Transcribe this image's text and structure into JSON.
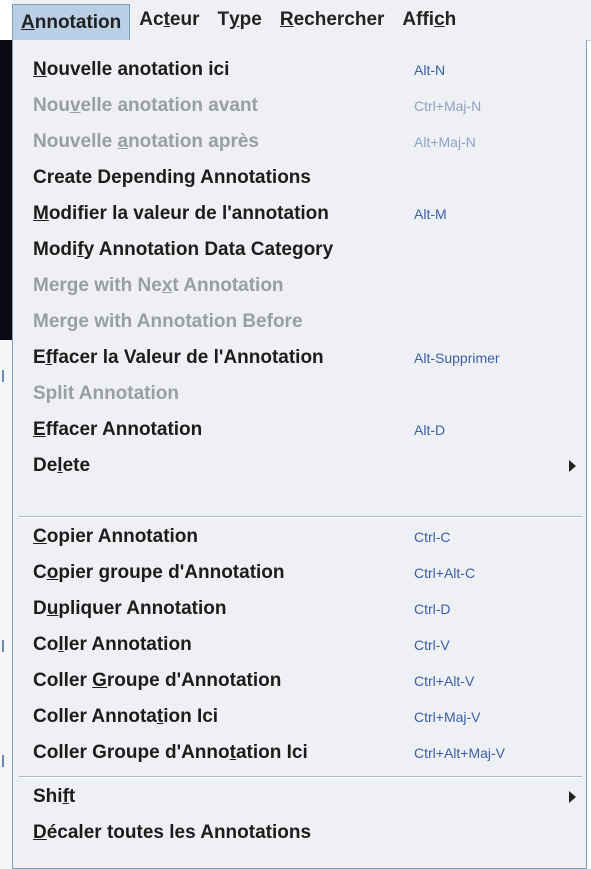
{
  "menubar": {
    "items": [
      {
        "pre": "",
        "u": "A",
        "post": "nnotation",
        "active": true
      },
      {
        "pre": "Ac",
        "u": "t",
        "post": "eur",
        "active": false
      },
      {
        "pre": "T",
        "u": "y",
        "post": "pe",
        "active": false
      },
      {
        "pre": "",
        "u": "R",
        "post": "echercher",
        "active": false
      },
      {
        "pre": "Affi",
        "u": "c",
        "post": "h",
        "active": false
      }
    ]
  },
  "menu": {
    "groups": [
      [
        {
          "pre": "",
          "u": "N",
          "post": "ouvelle anotation ici",
          "accel": "Alt-N",
          "enabled": true
        },
        {
          "pre": "Nou",
          "u": "v",
          "post": "elle anotation avant",
          "accel": "Ctrl+Maj-N",
          "enabled": false
        },
        {
          "pre": "Nouvelle ",
          "u": "a",
          "post": "notation après",
          "accel": "Alt+Maj-N",
          "enabled": false
        },
        {
          "pre": "Create Depending Annotations",
          "u": "",
          "post": "",
          "accel": "",
          "enabled": true
        },
        {
          "pre": "",
          "u": "M",
          "post": "odifier la valeur de l'annotation",
          "accel": "Alt-M",
          "enabled": true
        },
        {
          "pre": "Modi",
          "u": "f",
          "post": "y Annotation Data Category",
          "accel": "",
          "enabled": true
        },
        {
          "pre": "Merge with Ne",
          "u": "x",
          "post": "t Annotation",
          "accel": "",
          "enabled": false
        },
        {
          "pre": "Merge with Annotation Before",
          "u": "",
          "post": "",
          "accel": "",
          "enabled": false
        },
        {
          "pre": "E",
          "u": "f",
          "post": "facer la Valeur de l'Annotation",
          "accel": "Alt-Supprimer",
          "enabled": true
        },
        {
          "pre": "Split Annotation",
          "u": "",
          "post": "",
          "accel": "",
          "enabled": false
        },
        {
          "pre": "",
          "u": "E",
          "post": "ffacer Annotation",
          "accel": "Alt-D",
          "enabled": true
        },
        {
          "pre": "De",
          "u": "l",
          "post": "ete",
          "accel": "",
          "enabled": true,
          "submenu": true
        }
      ],
      [
        {
          "pre": "",
          "u": "C",
          "post": "opier Annotation",
          "accel": "Ctrl-C",
          "enabled": true
        },
        {
          "pre": "C",
          "u": "o",
          "post": "pier groupe d'Annotation",
          "accel": "Ctrl+Alt-C",
          "enabled": true
        },
        {
          "pre": "D",
          "u": "u",
          "post": "pliquer Annotation",
          "accel": "Ctrl-D",
          "enabled": true
        },
        {
          "pre": "Co",
          "u": "l",
          "post": "ler Annotation",
          "accel": "Ctrl-V",
          "enabled": true
        },
        {
          "pre": "Coller ",
          "u": "G",
          "post": "roupe d'Annotation",
          "accel": "Ctrl+Alt-V",
          "enabled": true
        },
        {
          "pre": "Coller Annota",
          "u": "t",
          "post": "ion Ici",
          "accel": "Ctrl+Maj-V",
          "enabled": true
        },
        {
          "pre": "Coller Groupe d'Anno",
          "u": "t",
          "post": "ation Ici",
          "accel": "Ctrl+Alt+Maj-V",
          "enabled": true
        }
      ],
      [
        {
          "pre": "Shi",
          "u": "f",
          "post": "t",
          "accel": "",
          "enabled": true,
          "submenu": true
        },
        {
          "pre": "",
          "u": "D",
          "post": "écaler toutes les Annotations",
          "accel": "",
          "enabled": true
        }
      ]
    ]
  }
}
